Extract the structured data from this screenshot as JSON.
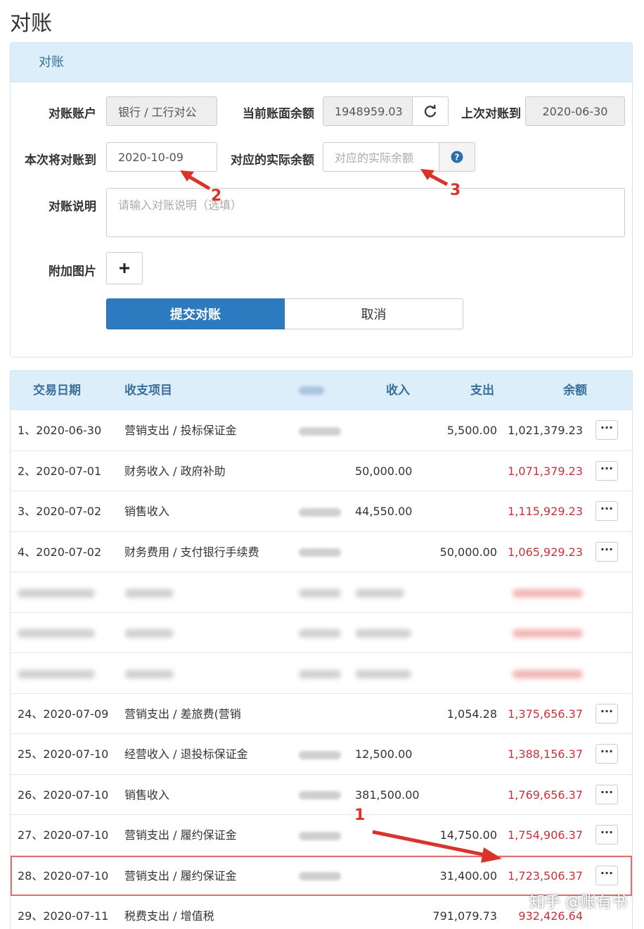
{
  "page": {
    "title": "对账"
  },
  "panel": {
    "heading": "对账",
    "account_label": "对账账户",
    "account_value": "银行 / 工行对公",
    "book_balance_label": "当前账面余额",
    "book_balance_value": "1948959.03",
    "last_recon_label": "上次对账到",
    "last_recon_value": "2020-06-30",
    "recon_to_label": "本次将对账到",
    "recon_to_value": "2020-10-09",
    "actual_balance_label": "对应的实际余额",
    "actual_balance_placeholder": "对应的实际余额",
    "note_label": "对账说明",
    "note_placeholder": "请输入对账说明（选填）",
    "image_label": "附加图片",
    "submit_label": "提交对账",
    "cancel_label": "取消"
  },
  "annotations": {
    "n1": "1",
    "n2": "2",
    "n3": "3",
    "arrow_color": "#d9342b"
  },
  "table": {
    "headers": {
      "date": "交易日期",
      "item": "收支项目",
      "income": "收入",
      "expense": "支出",
      "balance": "余额"
    },
    "more_label": "···",
    "rows": [
      {
        "date": "1、2020-06-30",
        "item": "营销支出 / 投标保证金",
        "income": "",
        "expense": "5,500.00",
        "balance": "1,021,379.23",
        "red": false
      },
      {
        "date": "2、2020-07-01",
        "item": "财务收入 / 政府补助",
        "income": "50,000.00",
        "expense": "",
        "balance": "1,071,379.23",
        "red": true
      },
      {
        "date": "3、2020-07-02",
        "item": "销售收入",
        "income": "44,550.00",
        "expense": "",
        "balance": "1,115,929.23",
        "red": true
      },
      {
        "date": "4、2020-07-02",
        "item": "财务费用 / 支付银行手续费",
        "income": "",
        "expense": "50,000.00",
        "balance": "1,065,929.23",
        "red": true
      },
      {
        "date": "24、2020-07-09",
        "item": "营销支出 / 差旅费(营销",
        "income": "",
        "expense": "1,054.28",
        "balance": "1,375,656.37",
        "red": true
      },
      {
        "date": "25、2020-07-10",
        "item": "经营收入 / 退投标保证金",
        "income": "12,500.00",
        "expense": "",
        "balance": "1,388,156.37",
        "red": true
      },
      {
        "date": "26、2020-07-10",
        "item": "销售收入",
        "income": "381,500.00",
        "expense": "",
        "balance": "1,769,656.37",
        "red": true
      },
      {
        "date": "27、2020-07-10",
        "item": "营销支出 / 履约保证金",
        "income": "",
        "expense": "14,750.00",
        "balance": "1,754,906.37",
        "red": true
      },
      {
        "date": "28、2020-07-10",
        "item": "营销支出 / 履约保证金",
        "income": "",
        "expense": "31,400.00",
        "balance": "1,723,506.37",
        "red": true
      },
      {
        "date": "29、2020-07-11",
        "item": "税费支出 / 增值税",
        "income": "",
        "expense": "791,079.73",
        "balance": "932,426.64",
        "red": true
      }
    ]
  },
  "watermark": "知乎 @账有书"
}
